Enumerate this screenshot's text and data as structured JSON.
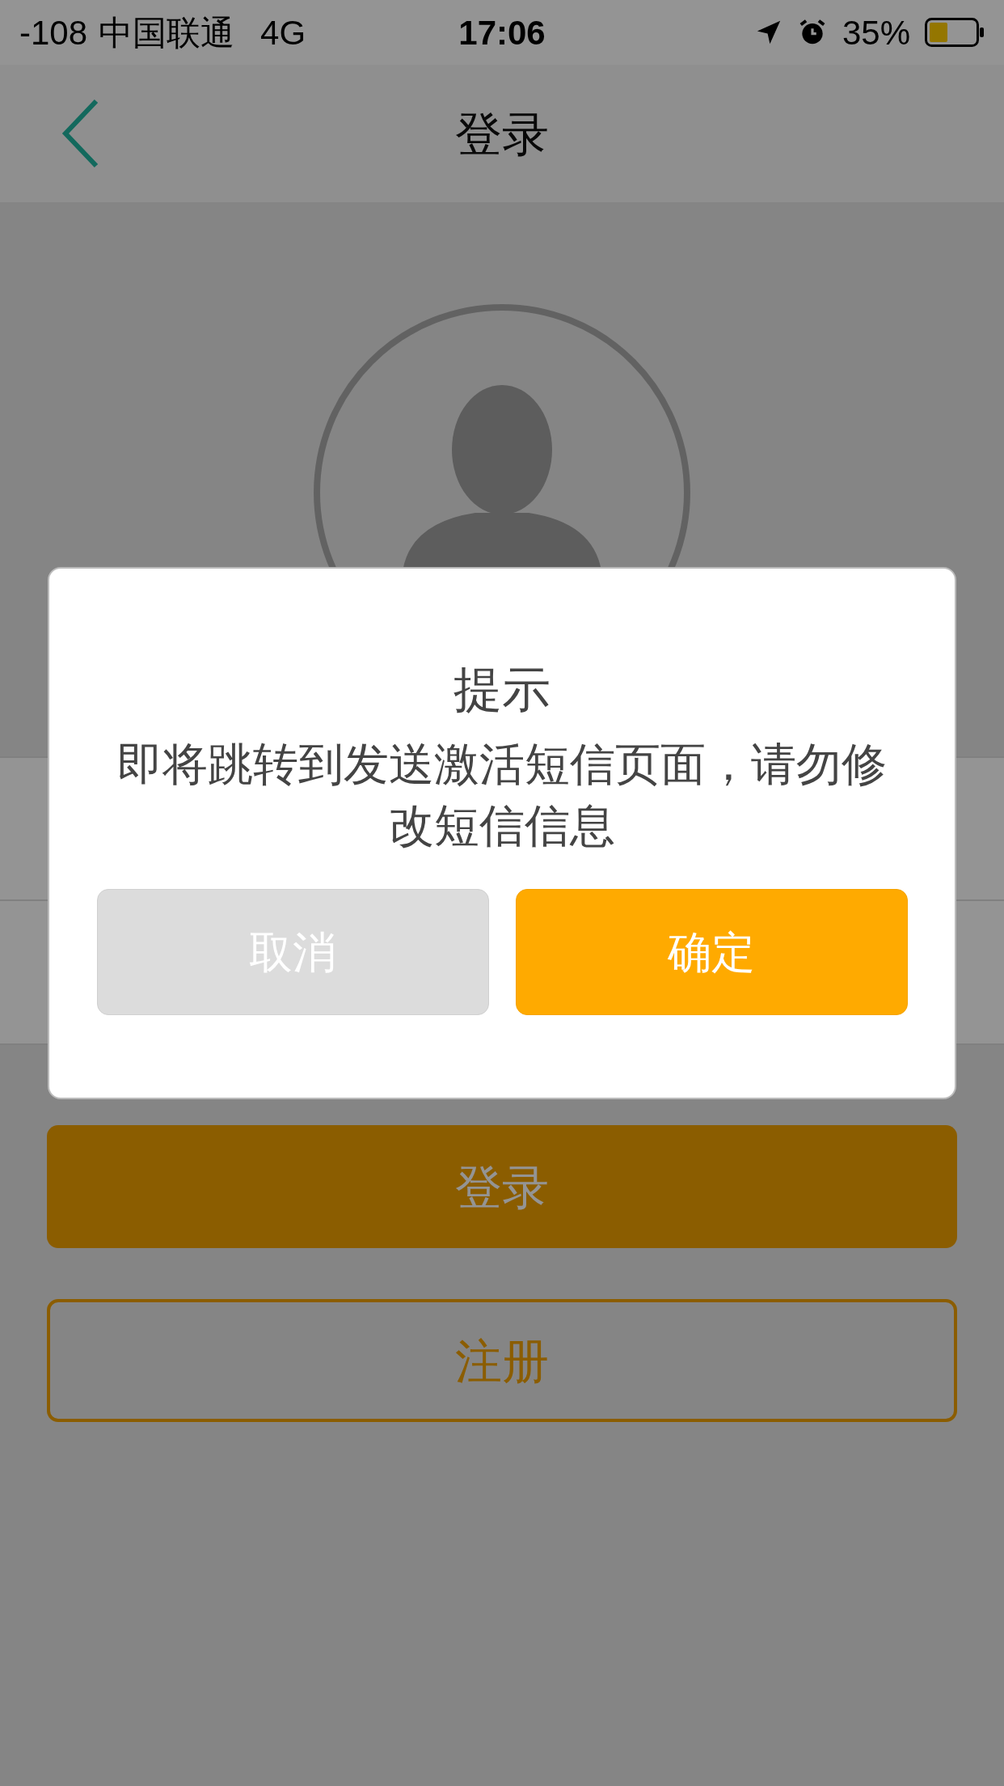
{
  "status_bar": {
    "signal": "-108",
    "carrier": "中国联通",
    "network": "4G",
    "time": "17:06",
    "battery": "35%"
  },
  "nav": {
    "title": "登录"
  },
  "login_button": "登录",
  "register_button": "注册",
  "dialog": {
    "title": "提示",
    "message": "即将跳转到发送激活短信页面，请勿修改短信信息",
    "buttons": [
      {
        "label": "取消",
        "kind": "cancel"
      },
      {
        "label": "确定",
        "kind": "confirm"
      }
    ]
  }
}
